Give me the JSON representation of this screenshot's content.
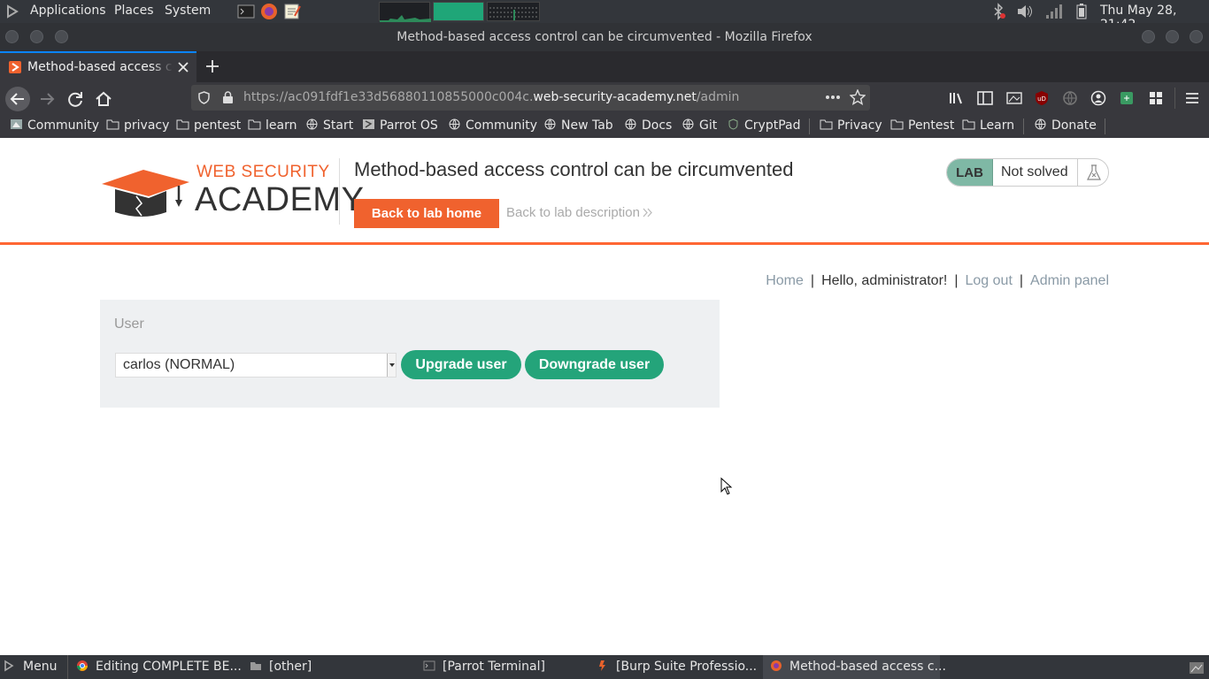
{
  "topbar": {
    "menus": [
      "Applications",
      "Places",
      "System"
    ],
    "clock": "Thu May 28, 21:42"
  },
  "window": {
    "title": "Method-based access control can be circumvented - Mozilla Firefox"
  },
  "tab": {
    "title": "Method-based access control can be circumvented"
  },
  "urlbar": {
    "prefix": "https://ac091fdf1e33d56880110855000c004c.",
    "host": "web-security-academy.net",
    "path": "/admin"
  },
  "bookmarks": [
    "Community",
    "privacy",
    "pentest",
    "learn",
    "Start",
    "Parrot OS",
    "Community",
    "New Tab",
    "Docs",
    "Git",
    "CryptPad",
    "Privacy",
    "Pentest",
    "Learn",
    "Donate"
  ],
  "header": {
    "logo_line1": "WEB SECURITY",
    "logo_line2": "ACADEMY",
    "lab_title": "Method-based access control can be circumvented",
    "back_home": "Back to lab home",
    "back_description": "Back to lab description",
    "lab_badge": "LAB",
    "lab_status": "Not solved"
  },
  "nav": {
    "home": "Home",
    "greeting": "Hello, administrator!",
    "logout": "Log out",
    "admin_panel": "Admin panel",
    "separator": "|"
  },
  "admin": {
    "user_label": "User",
    "selected_user": "carlos (NORMAL)",
    "upgrade": "Upgrade user",
    "downgrade": "Downgrade user"
  },
  "taskbar": {
    "menu": "Menu",
    "tasks": [
      "Editing COMPLETE BE...",
      "[other]",
      "[Parrot Terminal]",
      "[Burp Suite Professio...",
      "Method-based access c..."
    ]
  },
  "colors": {
    "accent_orange": "#f0622e",
    "button_green": "#24a47a",
    "lab_badge": "#7fb8a5"
  }
}
